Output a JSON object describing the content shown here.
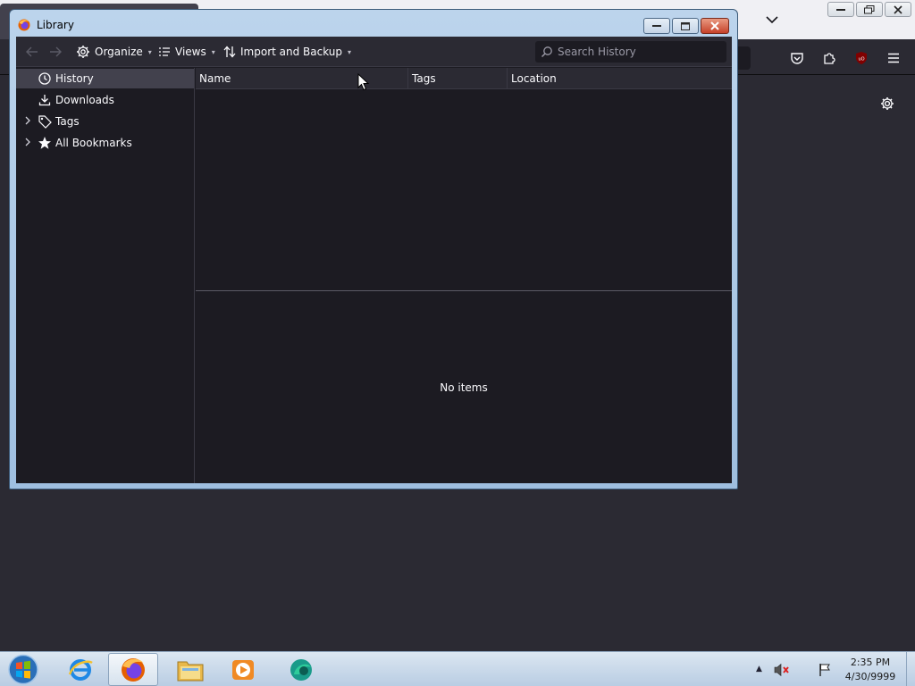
{
  "library": {
    "title": "Library",
    "toolbar": {
      "organize": "Organize",
      "views": "Views",
      "import_backup": "Import and Backup",
      "search_placeholder": "Search History"
    },
    "sidebar": [
      {
        "label": "History",
        "icon": "clock-icon",
        "selected": true,
        "expandable": false
      },
      {
        "label": "Downloads",
        "icon": "download-icon",
        "selected": false,
        "expandable": false
      },
      {
        "label": "Tags",
        "icon": "tag-icon",
        "selected": false,
        "expandable": true
      },
      {
        "label": "All Bookmarks",
        "icon": "star-icon",
        "selected": false,
        "expandable": true
      }
    ],
    "columns": [
      "Name",
      "Tags",
      "Location"
    ],
    "details_text": "No items"
  },
  "taskbar": {
    "time": "2:35 PM",
    "date": "4/30/9999",
    "apps": [
      "internet-explorer-icon",
      "firefox-icon",
      "file-explorer-icon",
      "media-player-icon",
      "app-icon"
    ]
  },
  "colors": {
    "dark_bg": "#1c1b22",
    "toolbar_bg": "#2b2a33",
    "text": "#fbfbfe",
    "selected_row": "#42414d"
  }
}
